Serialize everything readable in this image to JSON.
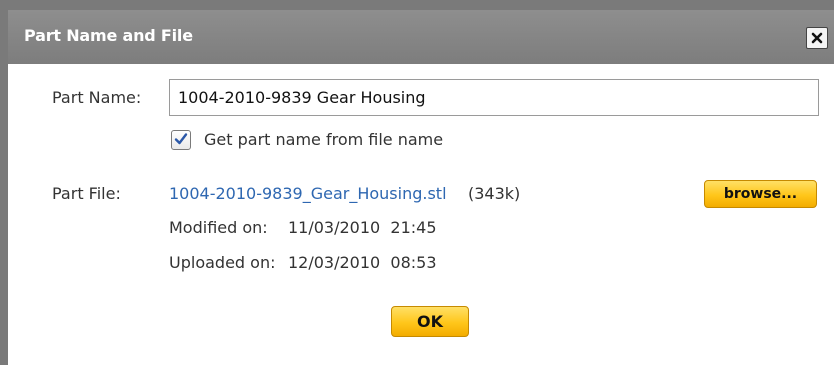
{
  "dialog": {
    "title": "Part Name and File",
    "close_icon": "close-icon"
  },
  "form": {
    "part_name_label": "Part Name:",
    "part_name_value": "1004-2010-9839 Gear Housing",
    "checkbox_checked": true,
    "checkbox_label": "Get part name from file name",
    "part_file_label": "Part File:",
    "file_name": "1004-2010-9839_Gear_Housing.stl",
    "file_size": "(343k)",
    "browse_label": "browse...",
    "modified_label": "Modified on:",
    "modified_value": "11/03/2010  21:45",
    "uploaded_label": "Uploaded on:",
    "uploaded_value": "12/03/2010  08:53"
  },
  "actions": {
    "ok_label": "OK"
  },
  "colors": {
    "titlebar": "#8a8a8a",
    "link": "#2e67b1",
    "button_yellow": "#ffc61a",
    "checkmark": "#2b58a8"
  }
}
